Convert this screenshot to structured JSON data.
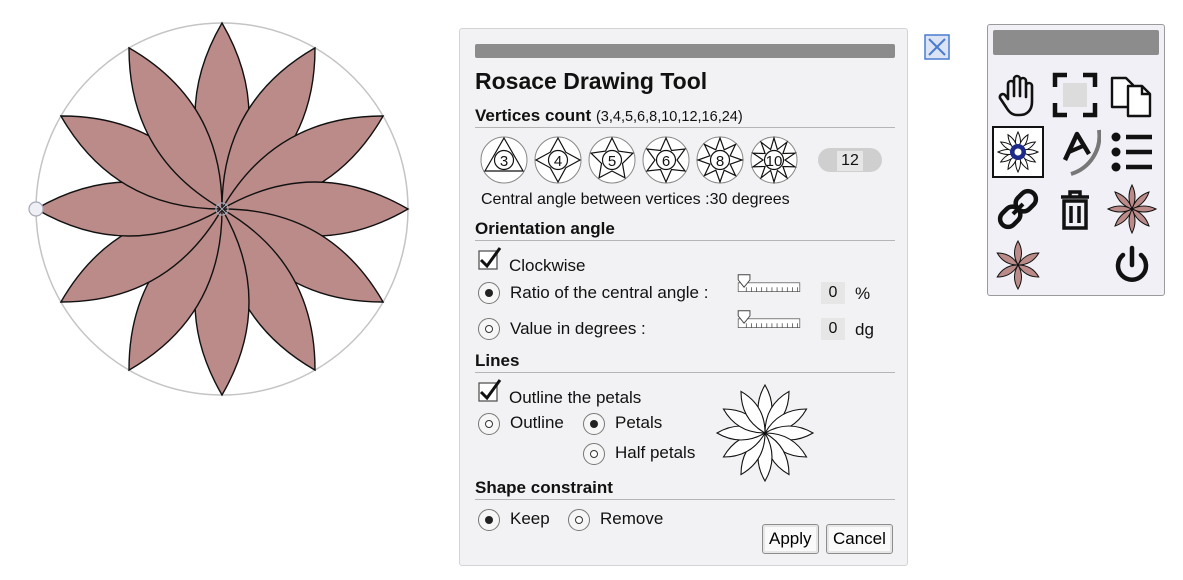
{
  "dialog": {
    "title": "Rosace Drawing Tool",
    "vertices": {
      "label": "Vertices count",
      "hint": "(3,4,5,6,8,10,12,16,24)",
      "options": [
        "3",
        "4",
        "5",
        "6",
        "8",
        "10"
      ],
      "current": "12",
      "central_angle_text": "Central angle between vertices :30 degrees"
    },
    "orientation": {
      "label": "Orientation angle",
      "clockwise_label": "Clockwise",
      "clockwise_checked": true,
      "ratio_label": "Ratio of the central angle :",
      "ratio_value": "0",
      "ratio_unit": "%",
      "degrees_label": "Value in degrees :",
      "degrees_value": "0",
      "degrees_unit": "dg",
      "selected": "ratio"
    },
    "lines": {
      "label": "Lines",
      "outline_petals_label": "Outline the petals",
      "outline_petals_checked": true,
      "outline_label": "Outline",
      "petals_label": "Petals",
      "half_petals_label": "Half petals",
      "selected": "petals"
    },
    "shape_constraint": {
      "label": "Shape constraint",
      "keep_label": "Keep",
      "remove_label": "Remove",
      "selected": "keep"
    },
    "apply_label": "Apply",
    "cancel_label": "Cancel"
  },
  "drawing": {
    "petal_count": 12,
    "petal_fill": "#bb8b89",
    "petal_stroke": "#111111",
    "circle_stroke": "#c4c4c4"
  },
  "toolbar": {
    "tools": [
      {
        "name": "hand-tool-icon",
        "active": false
      },
      {
        "name": "fullscreen-icon",
        "active": false
      },
      {
        "name": "duplicate-icon",
        "active": false
      },
      {
        "name": "rosace-tool-icon",
        "active": true
      },
      {
        "name": "angle-text-icon",
        "active": false
      },
      {
        "name": "list-icon",
        "active": false
      },
      {
        "name": "link-icon",
        "active": false
      },
      {
        "name": "trash-icon",
        "active": false
      },
      {
        "name": "rosace-star-icon",
        "active": false
      },
      {
        "name": "star-six-icon",
        "active": false
      },
      {
        "name": "power-icon",
        "active": false
      }
    ]
  },
  "colors": {
    "accent": "#4a7bd1",
    "petal": "#bb8b89",
    "titlebar": "#8c8c8c"
  }
}
